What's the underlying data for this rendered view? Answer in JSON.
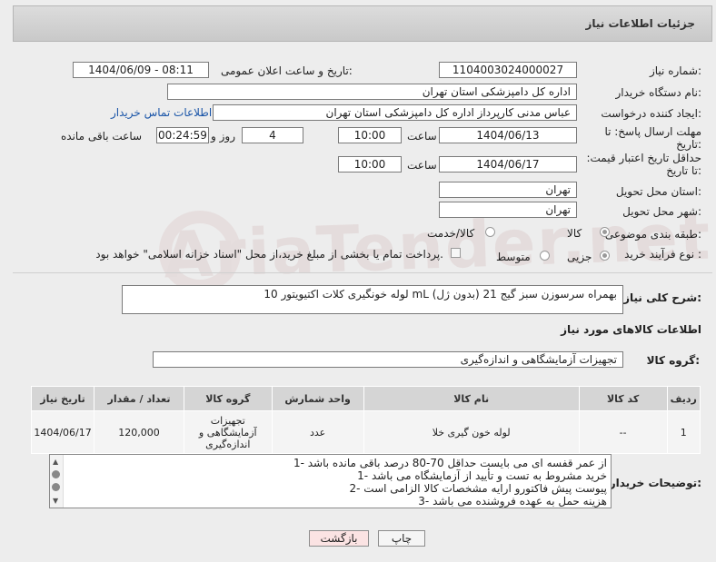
{
  "header": {
    "title": "جزئیات اطلاعات نیاز"
  },
  "watermark": "AriaTender.net",
  "form": {
    "need_number_label": "شماره نیاز:",
    "need_number": "1104003024000027",
    "announce_label": "تاریخ و ساعت اعلان عمومی:",
    "announce_value": "1404/06/09 - 08:11",
    "buyer_label": "نام دستگاه خریدار:",
    "buyer_value": "اداره کل دامپزشکی استان تهران",
    "creator_label": "ایجاد کننده درخواست:",
    "creator_value": "عباس  مدنی کارپرداز اداره کل دامپزشکی استان تهران",
    "contact_link": "اطلاعات تماس خریدار",
    "deadline_label": "مهلت ارسال پاسخ: تا تاریخ:",
    "deadline_date": "1404/06/13",
    "time_label": "ساعت",
    "deadline_time": "10:00",
    "days_value": "4",
    "days_label": "روز و",
    "remaining_time": "00:24:59",
    "remaining_label": "ساعت باقی مانده",
    "price_label": "حداقل تاریخ اعتبار قیمت: تا تاریخ:",
    "price_date": "1404/06/17",
    "price_time": "10:00",
    "province_label": "استان محل تحویل:",
    "province_value": "تهران",
    "city_label": "شهر محل تحویل:",
    "city_value": "تهران",
    "category_label": "طبقه بندی موضوعی:",
    "category_options": [
      "کالا",
      "کالا/خدمت"
    ],
    "process_label": "نوع فرآیند خرید :",
    "process_options": [
      "جزیی",
      "متوسط"
    ],
    "payment_note": "پرداخت تمام یا بخشی از مبلغ خرید،از محل \"اسناد خزانه اسلامی\" خواهد بود.",
    "desc_label": "شرح کلی نیاز:",
    "desc_value": "لوله خونگیری کلات اکتیویتور 10 mL (بدون ژل) بهمراه سرسوزن سبز گیج 21"
  },
  "items_section": {
    "title": "اطلاعات کالاهای مورد نیاز",
    "group_label": "گروه کالا:",
    "group_value": "تجهیزات آزمایشگاهی و اندازه‌گیری"
  },
  "table": {
    "headers": [
      "ردیف",
      "کد کالا",
      "نام کالا",
      "واحد شمارش",
      "گروه کالا",
      "تعداد / مقدار",
      "تاریخ نیاز"
    ],
    "rows": [
      [
        "1",
        "--",
        "لوله خون گیری خلا",
        "عدد",
        "تجهیزات آزمایشگاهی و اندازه‌گیری",
        "120,000",
        "1404/06/17"
      ]
    ]
  },
  "notes": {
    "label": "توضیحات خریدار:",
    "lines": [
      "1- از عمر قفسه ای می بایست حداقل 70-80 درصد باقی مانده باشد",
      "1- خرید مشروط به تست و تأیید از آزمایشگاه می باشد",
      "2- پیوست پیش فاکتورو ارایه مشخصات کالا الزامی است",
      "3- هزینه حمل به عهده فروشنده می باشد"
    ]
  },
  "buttons": {
    "print": "چاپ",
    "back": "بازگشت"
  },
  "colors": {
    "link": "#1a55a8",
    "back_button_bg": "#fbe3e3",
    "table_header": "#d5d5d5"
  }
}
